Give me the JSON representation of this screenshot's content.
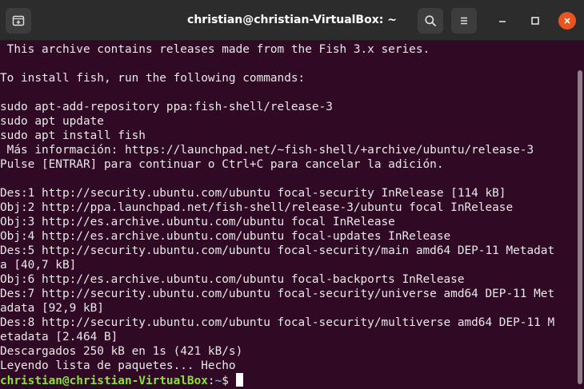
{
  "window": {
    "title": "christian@christian-VirtualBox: ~"
  },
  "terminal": {
    "lines": [
      " This archive contains releases made from the Fish 3.x series.",
      "",
      "To install fish, run the following commands:",
      "",
      "sudo apt-add-repository ppa:fish-shell/release-3",
      "sudo apt update",
      "sudo apt install fish",
      " Más información: https://launchpad.net/~fish-shell/+archive/ubuntu/release-3",
      "Pulse [ENTRAR] para continuar o Ctrl+C para cancelar la adición.",
      "",
      "Des:1 http://security.ubuntu.com/ubuntu focal-security InRelease [114 kB]",
      "Obj:2 http://ppa.launchpad.net/fish-shell/release-3/ubuntu focal InRelease",
      "Obj:3 http://es.archive.ubuntu.com/ubuntu focal InRelease",
      "Obj:4 http://es.archive.ubuntu.com/ubuntu focal-updates InRelease",
      "Des:5 http://security.ubuntu.com/ubuntu focal-security/main amd64 DEP-11 Metadat",
      "a [40,7 kB]",
      "Obj:6 http://es.archive.ubuntu.com/ubuntu focal-backports InRelease",
      "Des:7 http://security.ubuntu.com/ubuntu focal-security/universe amd64 DEP-11 Met",
      "adata [92,9 kB]",
      "Des:8 http://security.ubuntu.com/ubuntu focal-security/multiverse amd64 DEP-11 M",
      "etadata [2.464 B]",
      "Descargados 250 kB en 1s (421 kB/s)",
      "Leyendo lista de paquetes... Hecho"
    ],
    "prompt": {
      "user_host": "christian@christian-VirtualBox",
      "separator": ":",
      "path": "~",
      "symbol": "$ "
    }
  },
  "colors": {
    "background": "#300a24",
    "titlebar": "#2c2c2c",
    "prompt_user": "#8ae234",
    "prompt_path": "#729fcf",
    "close": "#e95420"
  },
  "icons": {
    "new_tab": "new-tab-icon",
    "search": "search-icon",
    "menu": "hamburger-menu-icon",
    "minimize": "minimize-icon",
    "maximize": "maximize-icon",
    "close": "close-icon"
  }
}
